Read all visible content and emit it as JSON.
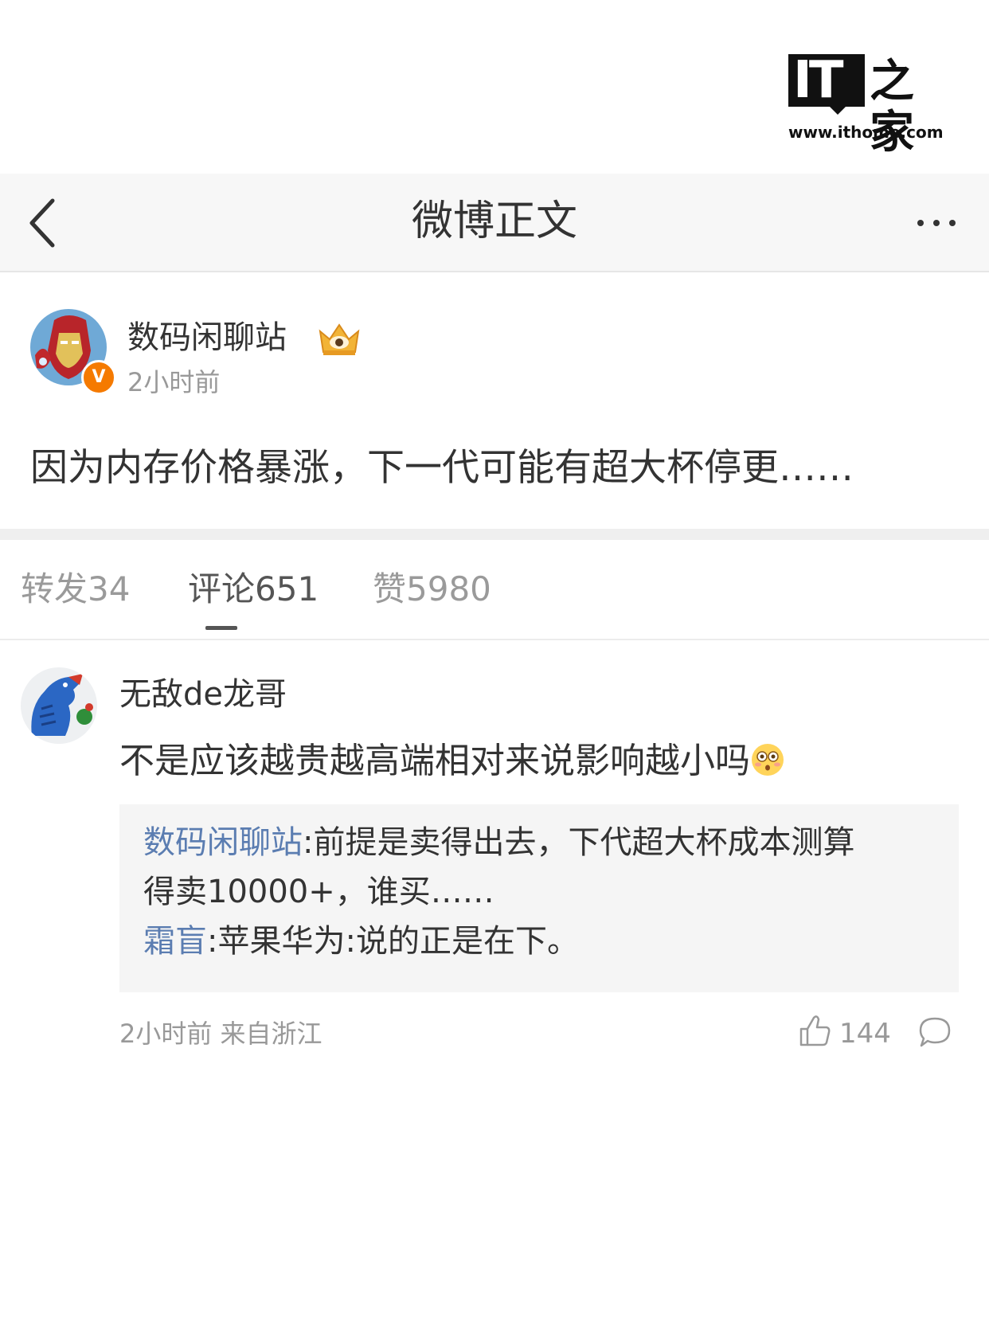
{
  "watermark": {
    "logo_it": "IT",
    "logo_zh": "之家",
    "url": "www.ithome.com"
  },
  "nav": {
    "title": "微博正文",
    "back_icon": "chevron-left-icon",
    "more_icon": "ellipsis-icon"
  },
  "post": {
    "author": "数码闲聊站",
    "verified_badge": "V",
    "time": "2小时前",
    "text": "因为内存价格暴涨，下一代可能有超大杯停更……"
  },
  "tabs": [
    {
      "label": "转发34",
      "active": false
    },
    {
      "label": "评论651",
      "active": true
    },
    {
      "label": "赞5980",
      "active": false
    }
  ],
  "comment": {
    "author": "无敌de龙哥",
    "text": "不是应该越贵越高端相对来说影响越小吗",
    "emoji": "flushed-face-emoji",
    "replies": [
      {
        "name": "数码闲聊站",
        "text": ":前提是卖得出去，下代超大杯成本测算"
      },
      {
        "name": "",
        "text": "得卖10000+，谁买……"
      },
      {
        "name": "霜盲",
        "text": ":苹果华为:说的正是在下。"
      }
    ],
    "meta": "2小时前 来自浙江",
    "likes": "144"
  },
  "colors": {
    "accent_link": "#5b7db1",
    "badge_orange": "#f57a00",
    "text_main": "#333333",
    "text_muted": "#999999"
  }
}
